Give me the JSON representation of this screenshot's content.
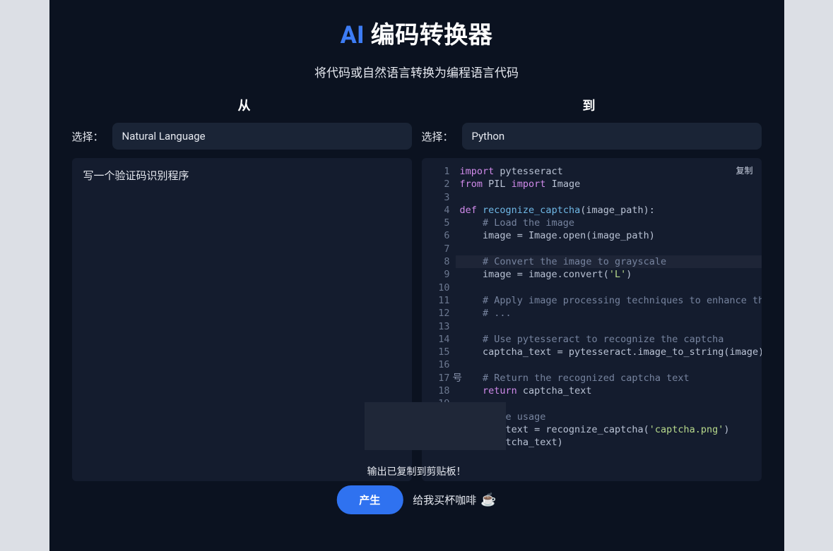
{
  "header": {
    "ai": "AI",
    "title_rest": " 编码转换器",
    "subtitle": "将代码或自然语言转换为编程语言代码"
  },
  "labels": {
    "from": "从",
    "to": "到",
    "select": "选择："
  },
  "selectors": {
    "from_value": "Natural Language",
    "to_value": "Python"
  },
  "input_panel": {
    "text": "写一个验证码识别程序"
  },
  "code": {
    "copy_label": "复制",
    "highlight_line": 8,
    "badge_text": "号",
    "badge_line": 17,
    "lines": [
      [
        [
          "kw",
          "import"
        ],
        [
          "pn",
          " pytesseract"
        ]
      ],
      [
        [
          "kw",
          "from"
        ],
        [
          "pn",
          " PIL "
        ],
        [
          "kw",
          "import"
        ],
        [
          "pn",
          " Image"
        ]
      ],
      [],
      [
        [
          "kw",
          "def"
        ],
        [
          "pn",
          " "
        ],
        [
          "fn",
          "recognize_captcha"
        ],
        [
          "pn",
          "(image_path):"
        ]
      ],
      [
        [
          "pn",
          "    "
        ],
        [
          "cm",
          "# Load the image"
        ]
      ],
      [
        [
          "pn",
          "    image = Image.open(image_path)"
        ]
      ],
      [],
      [
        [
          "pn",
          "    "
        ],
        [
          "cm",
          "# Convert the image to grayscale"
        ]
      ],
      [
        [
          "pn",
          "    image = image.convert("
        ],
        [
          "str",
          "'L'"
        ],
        [
          "pn",
          ")"
        ]
      ],
      [],
      [
        [
          "pn",
          "    "
        ],
        [
          "cm",
          "# Apply image processing techniques to enhance the"
        ]
      ],
      [
        [
          "pn",
          "    "
        ],
        [
          "cm",
          "# ..."
        ]
      ],
      [],
      [
        [
          "pn",
          "    "
        ],
        [
          "cm",
          "# Use pytesseract to recognize the captcha"
        ]
      ],
      [
        [
          "pn",
          "    captcha_text = pytesseract.image_to_string(image)"
        ]
      ],
      [],
      [
        [
          "pn",
          "    "
        ],
        [
          "cm",
          "# Return the recognized captcha text"
        ]
      ],
      [
        [
          "pn",
          "    "
        ],
        [
          "kw",
          "return"
        ],
        [
          "pn",
          " captcha_text"
        ]
      ],
      [],
      [
        [
          "cm",
          "# Example usage"
        ]
      ],
      [
        [
          "pn",
          "captcha_text = recognize_captcha("
        ],
        [
          "str",
          "'captcha.png'"
        ],
        [
          "pn",
          ")"
        ]
      ],
      [
        [
          "pn",
          "        tcha_text)"
        ]
      ]
    ]
  },
  "toast": "输出已复制到剪贴板！",
  "actions": {
    "generate": "产生",
    "coffee": "给我买杯咖啡"
  }
}
